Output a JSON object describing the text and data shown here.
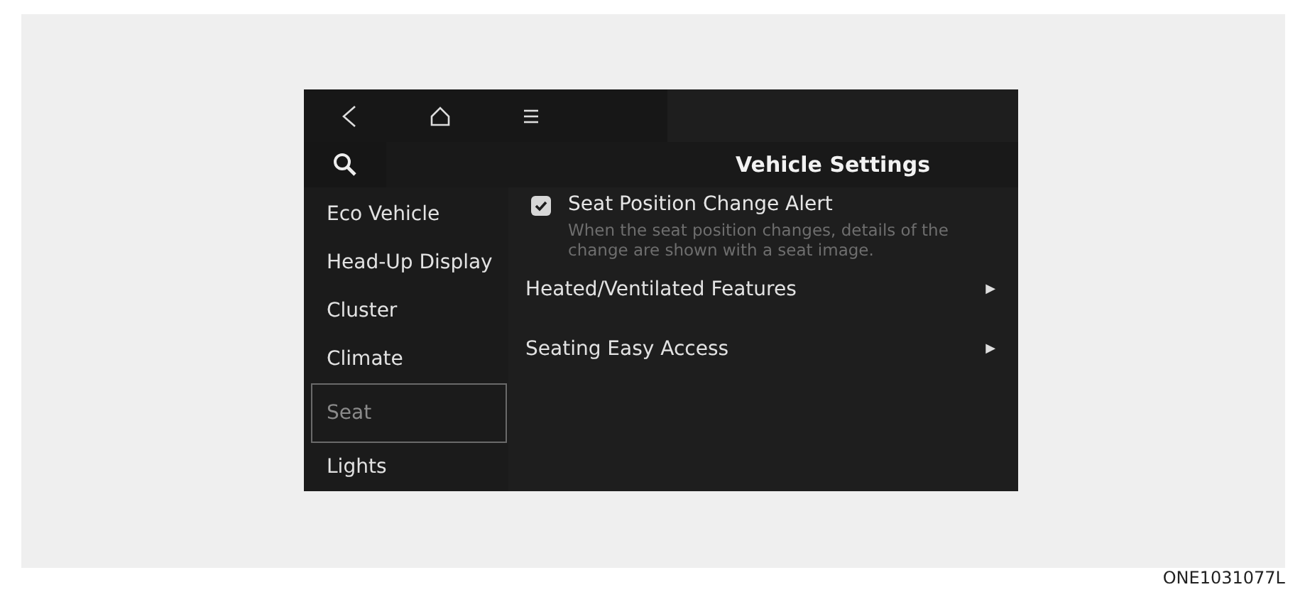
{
  "top_bar": {
    "buttons": [
      {
        "kind": "back"
      },
      {
        "kind": "home"
      },
      {
        "kind": "menu"
      }
    ]
  },
  "header": {
    "title": "Vehicle Settings"
  },
  "sidebar": {
    "items": [
      {
        "label": "Eco Vehicle",
        "selected": false
      },
      {
        "label": "Head-Up Display",
        "selected": false
      },
      {
        "label": "Cluster",
        "selected": false
      },
      {
        "label": "Climate",
        "selected": false
      },
      {
        "label": "Seat",
        "selected": true
      },
      {
        "label": "Lights",
        "selected": false
      }
    ]
  },
  "settings": [
    {
      "kind": "checkbox",
      "label": "Seat Position Change Alert",
      "checked": true,
      "description": "When the seat position changes, details of the change are shown with a seat image."
    },
    {
      "kind": "submenu",
      "label": "Heated/Ventilated Features",
      "arrow": "▶"
    },
    {
      "kind": "submenu",
      "label": "Seating Easy Access",
      "arrow": "▶"
    }
  ],
  "caption": "ONE1031077L"
}
